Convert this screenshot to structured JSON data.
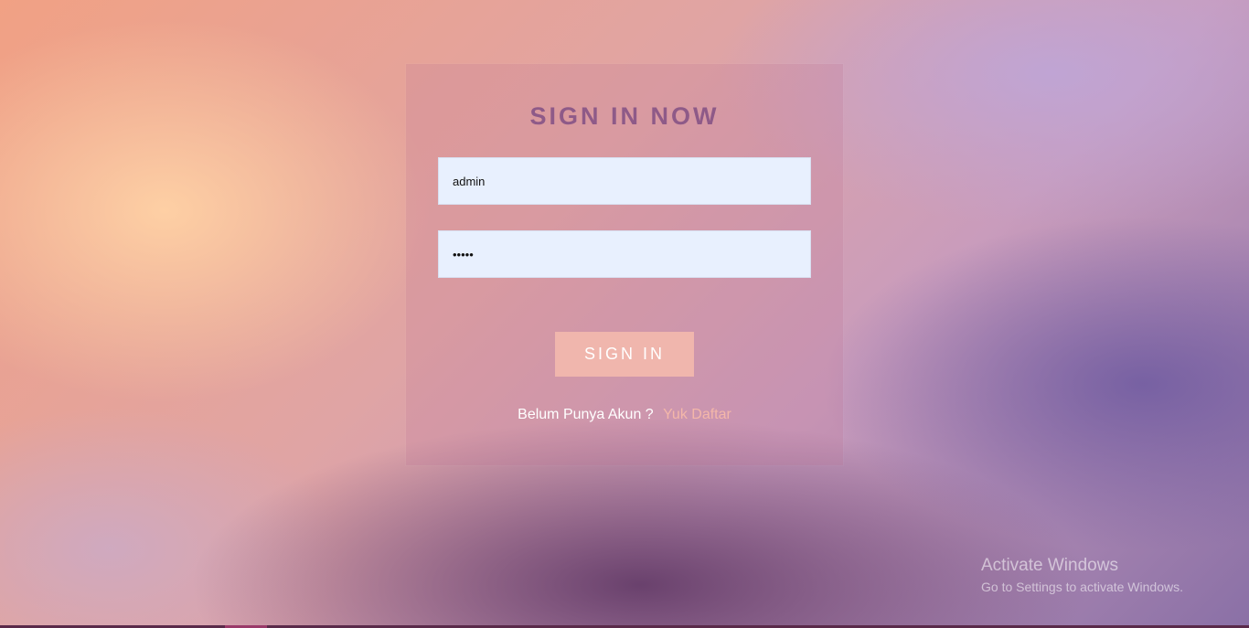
{
  "login": {
    "title": "SIGN IN NOW",
    "username_value": "admin",
    "password_value": "•••••",
    "submit_label": "SIGN IN",
    "register_prompt": "Belum Punya Akun ?",
    "register_link": "Yuk Daftar"
  },
  "watermark": {
    "line1": "Activate Windows",
    "line2": "Go to Settings to activate Windows."
  },
  "colors": {
    "title": "#8e5a88",
    "button": "#f0b6ad",
    "link": "#f4b7a9",
    "input_bg": "#e8f0fe"
  }
}
